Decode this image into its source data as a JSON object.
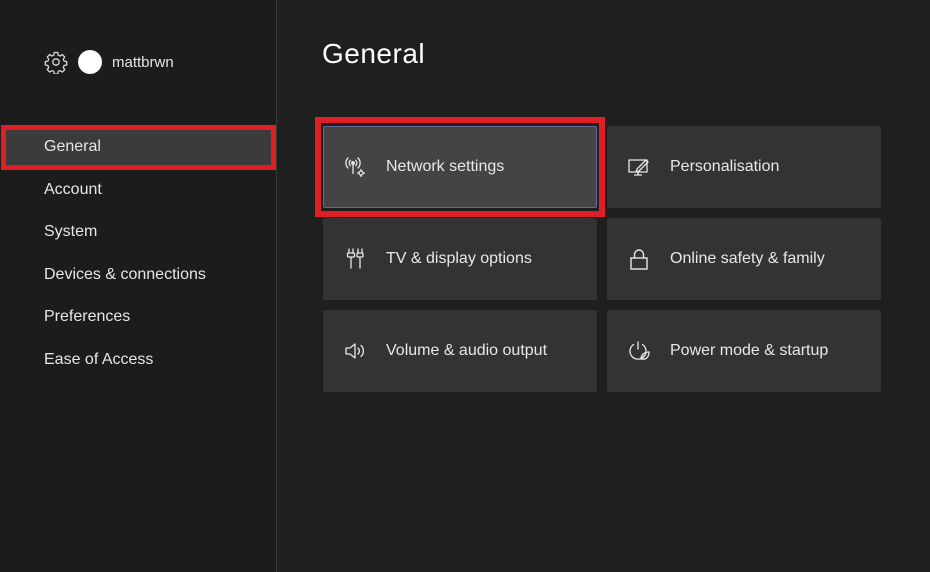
{
  "user": {
    "username": "mattbrwn",
    "settings_icon": "gear-icon"
  },
  "sidebar": {
    "items": [
      {
        "label": "General",
        "selected": true
      },
      {
        "label": "Account",
        "selected": false
      },
      {
        "label": "System",
        "selected": false
      },
      {
        "label": "Devices & connections",
        "selected": false
      },
      {
        "label": "Preferences",
        "selected": false
      },
      {
        "label": "Ease of Access",
        "selected": false
      }
    ]
  },
  "main": {
    "title": "General",
    "tiles": [
      {
        "label": "Network settings",
        "icon": "network-icon",
        "selected": true
      },
      {
        "label": "Personalisation",
        "icon": "personalisation-icon",
        "selected": false
      },
      {
        "label": "TV & display options",
        "icon": "tv-display-icon",
        "selected": false
      },
      {
        "label": "Online safety & family",
        "icon": "lock-icon",
        "selected": false
      },
      {
        "label": "Volume & audio output",
        "icon": "speaker-icon",
        "selected": false
      },
      {
        "label": "Power mode & startup",
        "icon": "power-icon",
        "selected": false
      }
    ]
  },
  "colors": {
    "highlight": "#e01e26",
    "background": "#1f1f1f",
    "tile": "#333333"
  }
}
